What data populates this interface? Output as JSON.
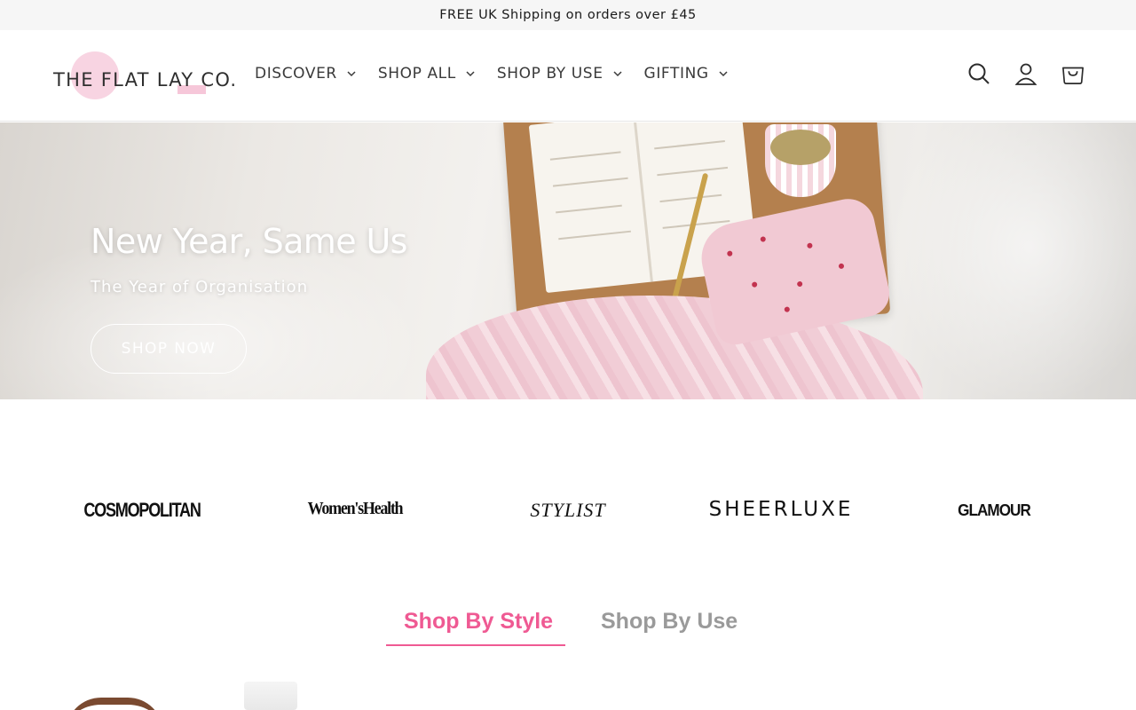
{
  "announcement": {
    "text": "FREE UK Shipping on orders over £45"
  },
  "header": {
    "logo_text": "THE FLAT LAY CO.",
    "nav": [
      {
        "label": "DISCOVER"
      },
      {
        "label": "SHOP ALL"
      },
      {
        "label": "SHOP BY USE"
      },
      {
        "label": "GIFTING"
      }
    ],
    "icons": [
      "search-icon",
      "account-icon",
      "cart-icon"
    ]
  },
  "hero": {
    "title": "New Year, Same Us",
    "subtitle": "The Year of Organisation",
    "cta": "SHOP NOW"
  },
  "press": {
    "logos": [
      "COSMOPOLITAN",
      "Women'sHealth",
      "STYLIST",
      "SHEERLUXE",
      "GLAMOUR"
    ]
  },
  "tabs": {
    "items": [
      {
        "label": "Shop By Style",
        "active": true
      },
      {
        "label": "Shop By Use",
        "active": false
      }
    ]
  },
  "colors": {
    "accent": "#ef5a93",
    "inactive_tab": "#9a9a9a",
    "announcement_bg": "#f6f6f6"
  }
}
